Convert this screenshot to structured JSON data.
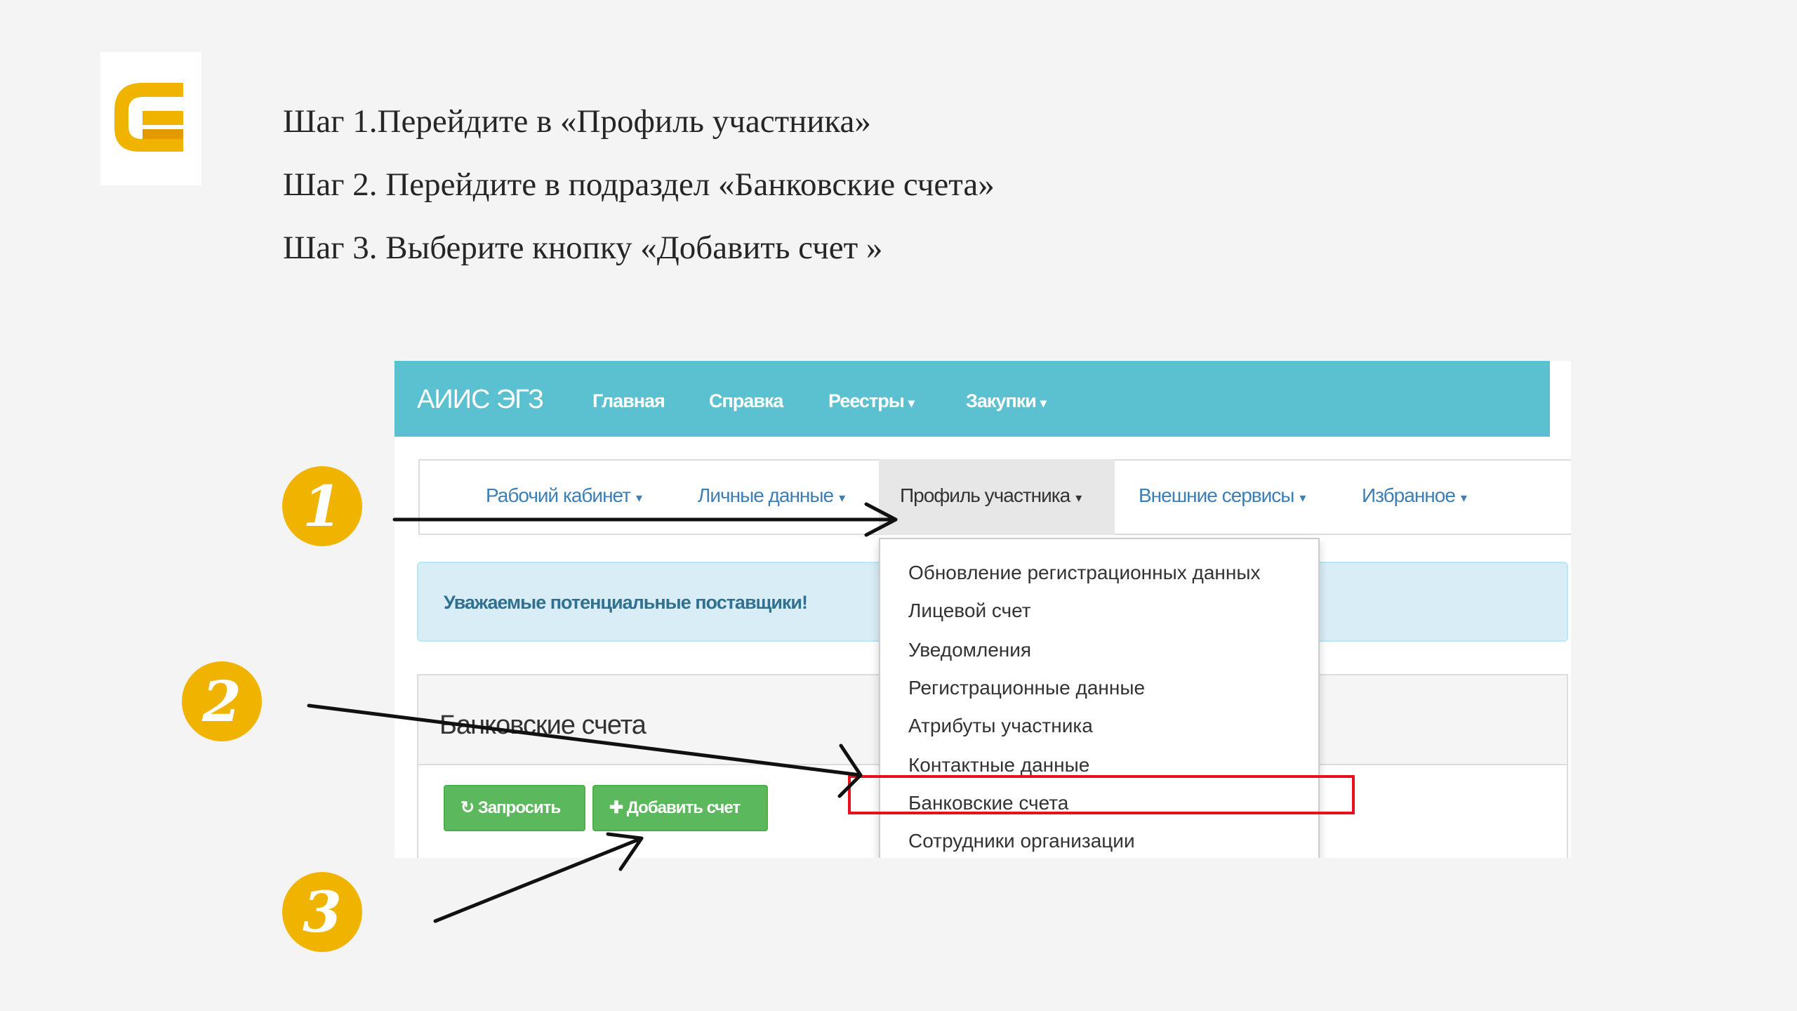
{
  "instructions": {
    "step1": "Шаг 1.Перейдите в «Профиль участника»",
    "step2": "Шаг 2. Перейдите в подраздел «Банковские счета»",
    "step3": "Шаг 3. Выберите кнопку «Добавить счет »"
  },
  "markers": [
    "1",
    "2",
    "3"
  ],
  "app": {
    "brand": "АИИС ЭГЗ",
    "top_nav": [
      {
        "label": "Главная",
        "caret": ""
      },
      {
        "label": "Справка",
        "caret": ""
      },
      {
        "label": "Реестры",
        "caret": "▾"
      },
      {
        "label": "Закупки",
        "caret": "▾"
      }
    ],
    "sub_nav": [
      {
        "label": "Рабочий кабинет",
        "caret": "▾"
      },
      {
        "label": "Личные данные",
        "caret": "▾"
      },
      {
        "label": "Профиль участника",
        "caret": "▾"
      },
      {
        "label": "Внешние сервисы",
        "caret": "▾"
      },
      {
        "label": "Избранное",
        "caret": "▾"
      }
    ],
    "alert": "Уважаемые потенциальные поставщики!",
    "panel_title": "Банковские счета",
    "buttons": {
      "request": "Запросить",
      "request_icon": "↻",
      "add": "Добавить счет",
      "add_icon": "✚"
    },
    "dropdown": [
      "Обновление регистрационных данных",
      "Лицевой счет",
      "Уведомления",
      "Регистрационные данные",
      "Атрибуты участника",
      "Контактные данные",
      "Банковские счета",
      "Сотрудники организации"
    ]
  },
  "colors": {
    "topbar": "#5bc0cf",
    "marker": "#f0b400",
    "highlight": "#e8101c",
    "button": "#5cb85c",
    "link": "#3d7fb5"
  }
}
